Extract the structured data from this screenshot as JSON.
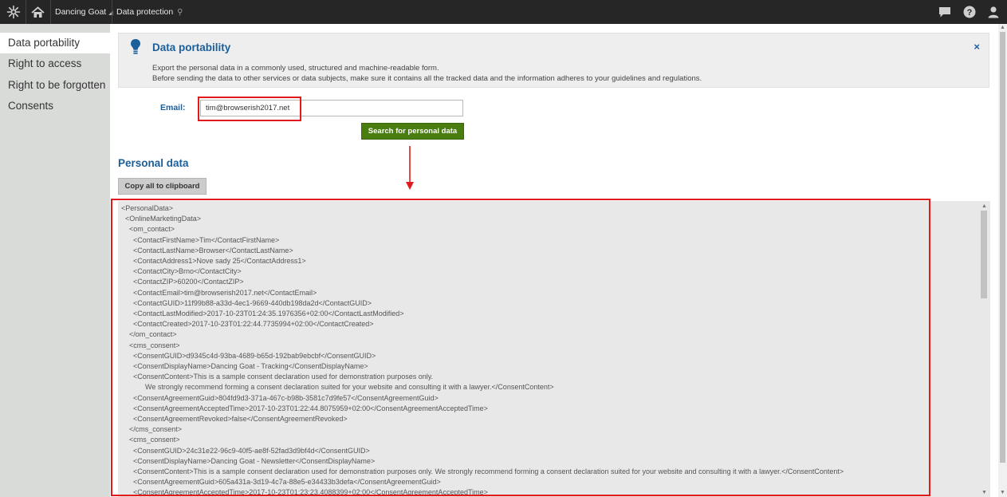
{
  "header": {
    "app_name": "Dancing Goat",
    "app_name_caret": "◢",
    "module_title": "Data protection",
    "pin_glyph": "⚲",
    "icons": [
      "kentico-logo-icon",
      "home-icon",
      "chat-icon",
      "help-icon",
      "user-icon"
    ]
  },
  "sidebar": {
    "items": [
      {
        "label": "Data portability"
      },
      {
        "label": "Right to access"
      },
      {
        "label": "Right to be forgotten"
      },
      {
        "label": "Consents"
      }
    ]
  },
  "info": {
    "title": "Data portability",
    "line1": "Export the personal data in a commonly used, structured and machine-readable form.",
    "line2": "Before sending the data to other services or data subjects, make sure it contains all the tracked data and the information adheres to your guidelines and regulations.",
    "close": "×"
  },
  "form": {
    "email_label": "Email:",
    "email_value": "tim@browserish2017.net",
    "search_label": "Search for personal data"
  },
  "personal_data": {
    "title": "Personal data",
    "copy_label": "Copy all to clipboard",
    "lines": [
      "<PersonalData>",
      "  <OnlineMarketingData>",
      "    <om_contact>",
      "      <ContactFirstName>Tim</ContactFirstName>",
      "      <ContactLastName>Browser</ContactLastName>",
      "      <ContactAddress1>Nove sady 25</ContactAddress1>",
      "      <ContactCity>Brno</ContactCity>",
      "      <ContactZIP>60200</ContactZIP>",
      "      <ContactEmail>tim@browserish2017.net</ContactEmail>",
      "      <ContactGUID>11f99b88-a33d-4ec1-9669-440db198da2d</ContactGUID>",
      "      <ContactLastModified>2017-10-23T01:24:35.1976356+02:00</ContactLastModified>",
      "      <ContactCreated>2017-10-23T01:22:44.7735994+02:00</ContactCreated>",
      "    </om_contact>",
      "    <cms_consent>",
      "      <ConsentGUID>d9345c4d-93ba-4689-b65d-192bab9ebcbf</ConsentGUID>",
      "      <ConsentDisplayName>Dancing Goat - Tracking</ConsentDisplayName>",
      "      <ConsentContent>This is a sample consent declaration used for demonstration purposes only.",
      "            We strongly recommend forming a consent declaration suited for your website and consulting it with a lawyer.</ConsentContent>",
      "      <ConsentAgreementGuid>804fd9d3-371a-467c-b98b-3581c7d9fe57</ConsentAgreementGuid>",
      "      <ConsentAgreementAcceptedTime>2017-10-23T01:22:44.8075959+02:00</ConsentAgreementAcceptedTime>",
      "      <ConsentAgreementRevoked>false</ConsentAgreementRevoked>",
      "    </cms_consent>",
      "    <cms_consent>",
      "      <ConsentGUID>24c31e22-96c9-40f5-ae8f-52fad3d9bf4d</ConsentGUID>",
      "      <ConsentDisplayName>Dancing Goat - Newsletter</ConsentDisplayName>",
      "      <ConsentContent>This is a sample consent declaration used for demonstration purposes only. We strongly recommend forming a consent declaration suited for your website and consulting it with a lawyer.</ConsentContent>",
      "      <ConsentAgreementGuid>605a431a-3d19-4c7a-88e5-e34433b3defa</ConsentAgreementGuid>",
      "      <ConsentAgreementAcceptedTime>2017-10-23T01:23:23.4088399+02:00</ConsentAgreementAcceptedTime>"
    ]
  },
  "colors": {
    "topbar": "#262626",
    "accent_blue": "#1a5e9a",
    "search_green": "#497d10",
    "highlight_red": "#e11b1b"
  }
}
